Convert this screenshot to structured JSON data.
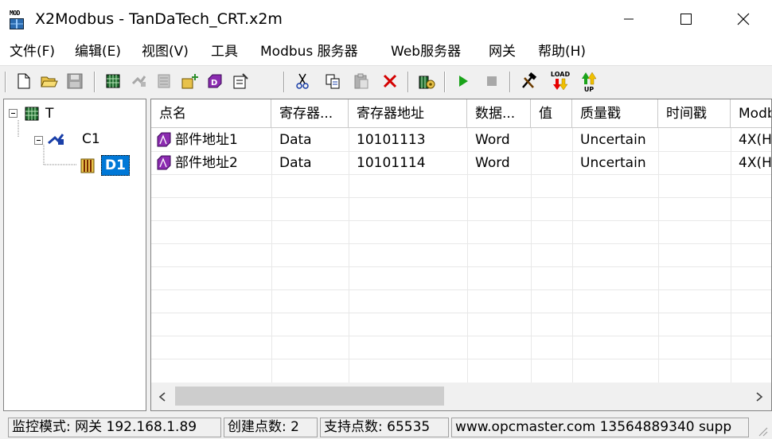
{
  "window": {
    "icon_text": "MOD",
    "title": "X2Modbus - TanDaTech_CRT.x2m"
  },
  "menu": {
    "items": [
      "文件(F)",
      "编辑(E)",
      "视图(V)",
      "工具",
      "Modbus 服务器",
      "Web服务器",
      "网关",
      "帮助(H)"
    ]
  },
  "toolbar": {
    "load_label": "LOAD",
    "up_label": "UP"
  },
  "tree": {
    "root": "T",
    "channel": "C1",
    "device": "D1"
  },
  "table": {
    "columns": [
      "点名",
      "寄存器...",
      "寄存器地址",
      "数据...",
      "值",
      "质量戳",
      "时间戳",
      "Modbus"
    ],
    "rows": [
      [
        "部件地址1",
        "Data",
        "10101113",
        "Word",
        "",
        "Uncertain",
        "",
        "4X(H"
      ],
      [
        "部件地址2",
        "Data",
        "10101114",
        "Word",
        "",
        "Uncertain",
        "",
        "4X(H"
      ]
    ]
  },
  "status": {
    "mode": "监控模式: 网关 192.168.1.89",
    "created": "创建点数: 2",
    "supported": "支持点数: 65535",
    "contact": "www.opcmaster.com 13564889340 supp"
  },
  "colors": {
    "selection": "#0078d7",
    "play_green": "#1aa31a",
    "delete_red": "#d40000",
    "tag_purple": "#8b2bb0"
  }
}
